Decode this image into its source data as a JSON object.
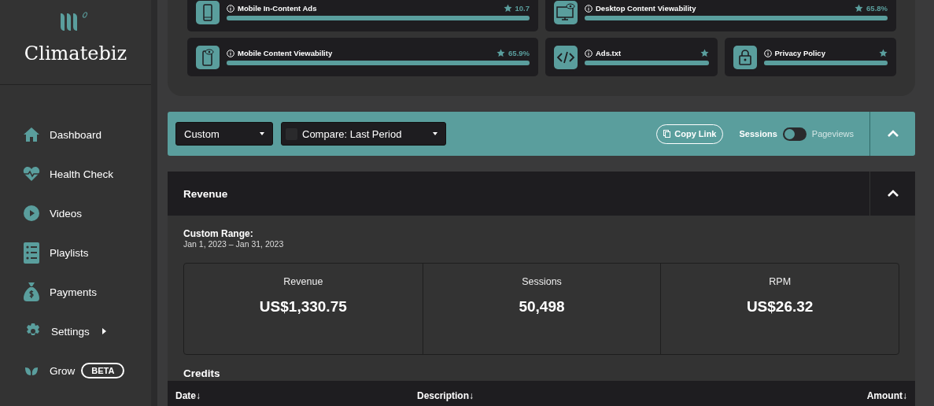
{
  "sidebar": {
    "brand": "Climatebiz",
    "items": [
      {
        "label": "Dashboard",
        "kind": "link"
      },
      {
        "label": "Health Check",
        "kind": "link"
      },
      {
        "label": "Videos",
        "kind": "link"
      },
      {
        "label": "Playlists",
        "kind": "link"
      },
      {
        "label": "Payments",
        "kind": "link"
      },
      {
        "label": "Settings",
        "kind": "submenu"
      },
      {
        "label": "Grow",
        "kind": "badge",
        "badge": "BETA"
      }
    ]
  },
  "health_check": {
    "cards": [
      {
        "title": "Mobile In-Content Ads",
        "score": "10.7",
        "level": 1,
        "kind": "wide"
      },
      {
        "title": "Desktop Content Viewability",
        "score": "65.8%",
        "level": 1,
        "kind": "wide"
      },
      {
        "title": "Mobile Content Viewability",
        "score": "65.9%",
        "level": 1,
        "kind": "wide"
      },
      {
        "title": "Ads.txt",
        "level": 1,
        "kind": "narrow"
      },
      {
        "title": "Privacy Policy",
        "level": 1,
        "kind": "narrow"
      }
    ]
  },
  "toolbar": {
    "range": "Custom",
    "compare": "Compare: Last Period",
    "copy_link": "Copy Link",
    "toggle": {
      "left_label": "Sessions",
      "right_label": "Pageviews",
      "on": false
    },
    "expanded": true
  },
  "revenue": {
    "title": "Revenue",
    "expanded": true,
    "range_label": "Custom Range:",
    "range": "Jan 1, 2023 – Jan 31, 2023",
    "stats": [
      {
        "label": "Revenue",
        "value": "US$1,330.75"
      },
      {
        "label": "Sessions",
        "value": "50,498"
      },
      {
        "label": "RPM",
        "value": "US$26.32"
      }
    ],
    "credits_title": "Credits",
    "columns": [
      {
        "label": "Date↓"
      },
      {
        "label": "Description↓"
      },
      {
        "label": "Amount↓"
      }
    ]
  }
}
